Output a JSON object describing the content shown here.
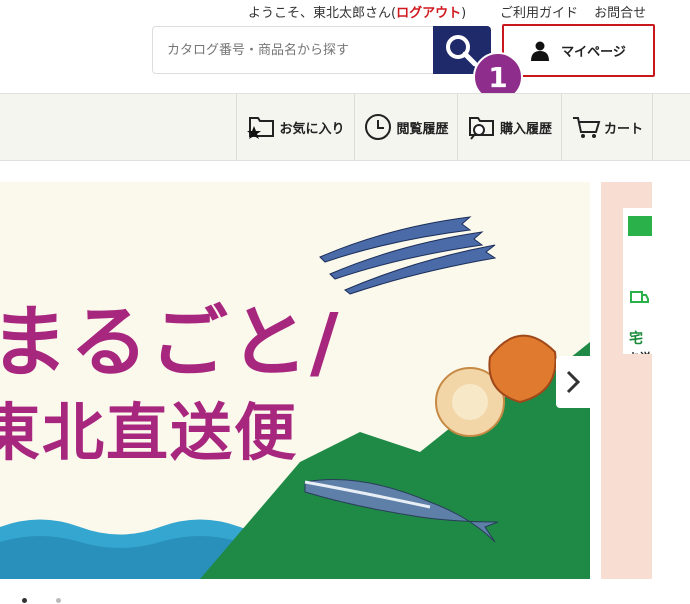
{
  "header": {
    "welcome_prefix": "ようこそ、東北太郎さん(",
    "logout_label": "ログアウト",
    "welcome_suffix": ")",
    "guide_label": "ご利用ガイド",
    "contact_label": "お問合せ",
    "search_placeholder": "カタログ番号・商品名から探す",
    "mypage_label": "マイページ",
    "step_badge": "1"
  },
  "nav": {
    "favorites": "お気に入り",
    "history": "閲覧履歴",
    "purchases": "購入履歴",
    "cart": "カート"
  },
  "banner": {
    "line1": "まるごと/",
    "line2": "東北直送便"
  },
  "side": {
    "kanji": "宅",
    "small": "お送"
  },
  "colors": {
    "accent_red": "#c8171d",
    "navy": "#1f2a6b",
    "badge_purple": "#8e2d8c",
    "banner_magenta": "#a7267e"
  }
}
